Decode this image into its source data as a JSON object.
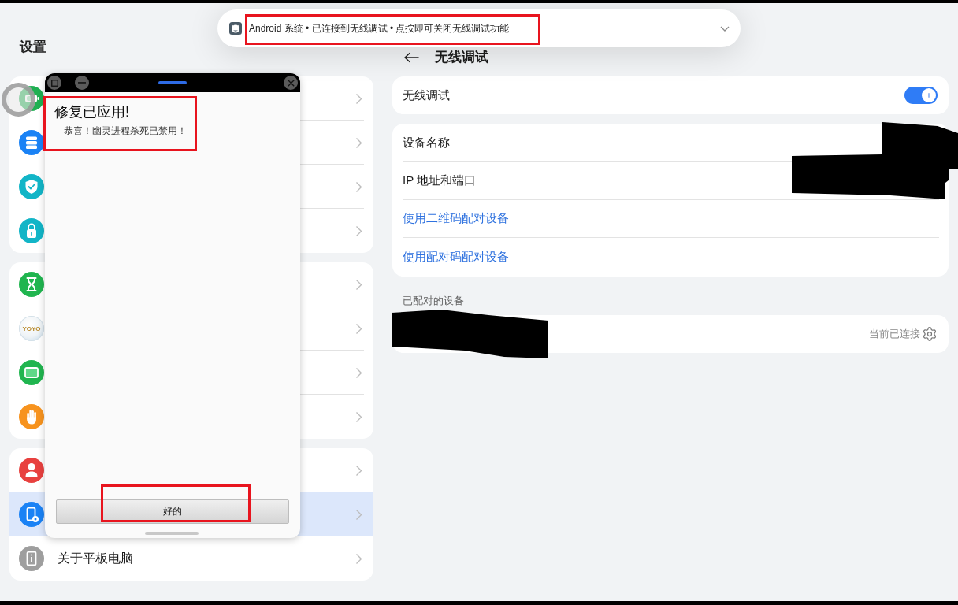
{
  "notification": {
    "text": "Android 系统 • 已连接到无线调试 • 点按即可关闭无线调试功能",
    "highlighted": true
  },
  "sidebar": {
    "title": "设置",
    "groups": [
      {
        "items": [
          {
            "selected": false
          },
          {
            "selected": false
          },
          {
            "selected": false
          },
          {
            "selected": false
          }
        ]
      },
      {
        "items": [
          {
            "selected": false
          },
          {
            "logo_text": "YOYO",
            "selected": false
          },
          {
            "selected": false
          },
          {
            "selected": false
          }
        ]
      },
      {
        "items": [
          {
            "selected": false
          },
          {
            "selected": true
          },
          {
            "label": "关于平板电脑",
            "selected": false
          }
        ]
      }
    ]
  },
  "floating_window": {
    "title": "修复已应用!",
    "message": "恭喜！幽灵进程杀死已禁用！",
    "message_highlighted": true,
    "button": "好的",
    "button_highlighted": true
  },
  "detail": {
    "title": "无线调试",
    "switch_row": {
      "label": "无线调试",
      "on": true
    },
    "rows": [
      {
        "kind": "info",
        "label": "设备名称"
      },
      {
        "kind": "info",
        "label": "IP 地址和端口"
      },
      {
        "kind": "link",
        "label": "使用二维码配对设备"
      },
      {
        "kind": "link",
        "label": "使用配对码配对设备"
      }
    ],
    "values_redacted": true,
    "paired_title": "已配对的设备",
    "paired_devices": [
      {
        "name_redacted": true,
        "status": "当前已连接"
      }
    ]
  }
}
